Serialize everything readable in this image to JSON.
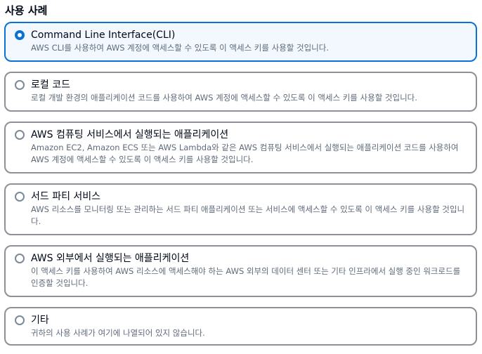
{
  "section": {
    "title": "사용 사례"
  },
  "options": [
    {
      "title": "Command Line Interface(CLI)",
      "description": "AWS CLI를 사용하여 AWS 계정에 액세스할 수 있도록 이 액세스 키를 사용할 것입니다.",
      "selected": true
    },
    {
      "title": "로컬 코드",
      "description": "로컬 개발 환경의 애플리케이션 코드를 사용하여 AWS 계정에 액세스할 수 있도록 이 액세스 키를 사용할 것입니다.",
      "selected": false
    },
    {
      "title": "AWS 컴퓨팅 서비스에서 실행되는 애플리케이션",
      "description": "Amazon EC2, Amazon ECS 또는 AWS Lambda와 같은 AWS 컴퓨팅 서비스에서 실행되는 애플리케이션 코드를 사용하여 AWS 계정에 액세스할 수 있도록 이 액세스 키를 사용할 것입니다.",
      "selected": false
    },
    {
      "title": "서드 파티 서비스",
      "description": "AWS 리소스를 모니터링 또는 관리하는 서드 파티 애플리케이션 또는 서비스에 액세스할 수 있도록 이 액세스 키를 사용할 것입니다.",
      "selected": false
    },
    {
      "title": "AWS 외부에서 실행되는 애플리케이션",
      "description": "이 액세스 키를 사용하여 AWS 리소스에 액세스해야 하는 AWS 외부의 데이터 센터 또는 기타 인프라에서 실행 중인 워크로드를 인증할 것입니다.",
      "selected": false
    },
    {
      "title": "기타",
      "description": "귀하의 사용 사례가 여기에 나열되어 있지 않습니다.",
      "selected": false
    }
  ],
  "colors": {
    "selected_border": "#0972d3",
    "selected_background": "#f2f8fd",
    "default_border": "#8d9096",
    "description_text": "#5f6b7a"
  }
}
